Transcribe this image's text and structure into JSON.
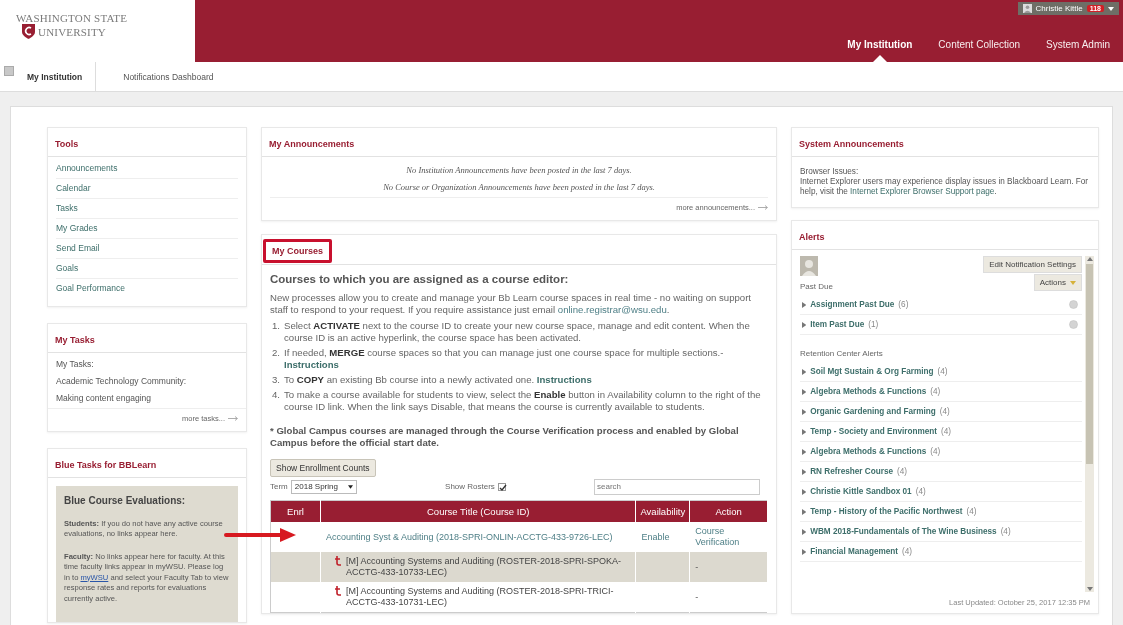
{
  "header": {
    "logo": {
      "line1": "WASHINGTON STATE",
      "line2": "UNIVERSITY"
    },
    "user": {
      "name": "Christie Kittle",
      "badge": "118"
    },
    "nav": [
      {
        "label": "My Institution",
        "selected": true
      },
      {
        "label": "Content Collection",
        "selected": false
      },
      {
        "label": "System Admin",
        "selected": false
      }
    ]
  },
  "subtabs": [
    {
      "label": "My Institution",
      "selected": true
    },
    {
      "label": "Notifications Dashboard",
      "selected": false
    }
  ],
  "tools": {
    "title": "Tools",
    "items": [
      "Announcements",
      "Calendar",
      "Tasks",
      "My Grades",
      "Send Email",
      "Goals",
      "Goal Performance"
    ]
  },
  "my_tasks": {
    "title": "My Tasks",
    "items": [
      "My Tasks:",
      "Academic Technology Community:",
      "Making content engaging"
    ],
    "more": "more tasks..."
  },
  "blue_tasks": {
    "title": "Blue Tasks for BBLearn",
    "heading": "Blue Course Evaluations:",
    "paragraphs": [
      {
        "text_before": "**Students:** If you do not have any active course evaluations, no links appear here."
      },
      {
        "text_before": "**Faculty:** No links appear here for faculty. At this time faculty links appear in myWSU. Please log in to ",
        "link": "myWSU",
        "text_after": " and select your Faculty Tab to view response rates and reports for evaluations currently active."
      }
    ]
  },
  "announcements": {
    "title": "My Announcements",
    "messages": [
      "No Institution Announcements have been posted in the last 7 days.",
      "No Course or Organization Announcements have been posted in the last 7 days."
    ],
    "more": "more announcements..."
  },
  "my_courses": {
    "title": "My Courses",
    "highlighted": true,
    "heading": "Courses to which you are assigned as a course editor:",
    "intro": {
      "text_before": "New processes allow you to create and manage your Bb Learn course spaces in real time - no waiting on support staff to respond to your request. If you require assistance just email ",
      "link": "online.registrar@wsu.edu",
      "text_after": "."
    },
    "steps": [
      {
        "number": "1.",
        "text": "Select **ACTIVATE** next to the course ID to create your new course space, manage and edit content. When the course ID is an active hyperlink, the course space has been activated."
      },
      {
        "number": "2.",
        "text": "If needed, **MERGE** course spaces so that you can manage just one course space for multiple sections.-",
        "link": "Instructions"
      },
      {
        "number": "3.",
        "text": "To **COPY** an existing Bb course into a newly activated one.",
        "link": "Instructions"
      },
      {
        "number": "4.",
        "text": "To make a course available for students to view, select the **Enable** button in Availability column to the right of the course ID link. When the link says Disable, that means the course is currently available to students."
      }
    ],
    "note": "* Global Campus courses are managed through the Course Verification process and enabled by Global Campus before the official start date.",
    "enrollment_button": "Show Enrollment Counts",
    "term_label": "Term",
    "term_value": "2018 Spring",
    "show_rosters": {
      "label": "Show Rosters",
      "checked": true
    },
    "search_placeholder": "search",
    "columns": [
      "Enrl",
      "Course Title (Course ID)",
      "Availability",
      "Action"
    ],
    "rows": [
      {
        "kind": "course",
        "pointed": true,
        "title": "Accounting Syst & Auditing (2018-SPRI-ONLIN-ACCTG-433-9726-LEC)",
        "availability": "Enable",
        "action": "Course Verification"
      },
      {
        "kind": "roster",
        "pointed": false,
        "title": "[M] Accounting Systems and Auditing (ROSTER-2018-SPRI-SPOKA-ACCTG-433-10733-LEC)",
        "action": "-"
      },
      {
        "kind": "roster",
        "pointed": false,
        "title": "[M] Accounting Systems and Auditing (ROSTER-2018-SPRI-TRICI-ACCTG-433-10731-LEC)",
        "action": "-"
      }
    ]
  },
  "system_announcements": {
    "title": "System Announcements",
    "heading": "Browser Issues:",
    "text_before": "Internet Explorer users may experience display issues in Blackboard Learn. For help, visit the ",
    "link": "Internet Explorer Browser Support page",
    "text_after": "."
  },
  "alerts": {
    "title": "Alerts",
    "settings_button": "Edit Notification Settings",
    "actions_button": "Actions",
    "sections": [
      {
        "label": "Past Due",
        "dismissable": true,
        "items": [
          {
            "name": "Assignment Past Due",
            "count": "(6)"
          },
          {
            "name": "Item Past Due",
            "count": "(1)"
          }
        ]
      },
      {
        "label": "Retention Center Alerts",
        "dismissable": false,
        "items": [
          {
            "name": "Soil Mgt Sustain & Org Farming",
            "count": "(4)"
          },
          {
            "name": "Algebra Methods & Functions",
            "count": "(4)"
          },
          {
            "name": "Organic Gardening and Farming",
            "count": "(4)"
          },
          {
            "name": "Temp - Society and Environment",
            "count": "(4)"
          },
          {
            "name": "Algebra Methods & Functions",
            "count": "(4)"
          },
          {
            "name": "RN Refresher Course",
            "count": "(4)"
          },
          {
            "name": "Christie Kittle Sandbox 01",
            "count": "(4)"
          },
          {
            "name": "Temp - History of the Pacific Northwest",
            "count": "(4)"
          },
          {
            "name": "WBM 2018-Fundamentals of The Wine Business",
            "count": "(4)"
          },
          {
            "name": "Financial Management",
            "count": "(4)"
          }
        ]
      }
    ],
    "updated": "Last Updated: October 25, 2017 12:35 PM"
  }
}
